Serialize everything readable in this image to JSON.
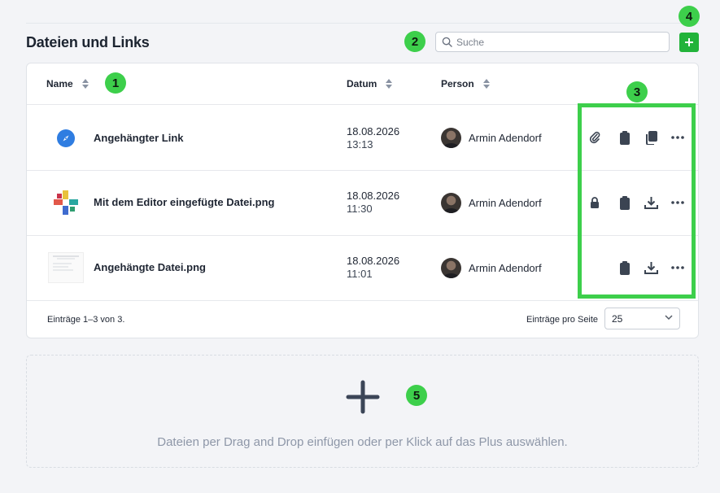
{
  "section": {
    "title": "Dateien und Links"
  },
  "search": {
    "placeholder": "Suche",
    "value": ""
  },
  "toolbar": {
    "add_icon": "plus-icon"
  },
  "table": {
    "columns": [
      {
        "label": "Name"
      },
      {
        "label": "Datum"
      },
      {
        "label": "Person"
      }
    ],
    "rows": [
      {
        "name": "Angehängter Link",
        "date": "18.08.2026",
        "time": "13:13",
        "person": "Armin Adendorf",
        "type": "link",
        "actions": [
          "paperclip-icon",
          "clipboard-icon",
          "copy-icon",
          "more-icon"
        ]
      },
      {
        "name": "Mit dem Editor eingefügte Datei.png",
        "date": "18.08.2026",
        "time": "11:30",
        "person": "Armin Adendorf",
        "type": "image",
        "actions": [
          "lock-icon",
          "clipboard-icon",
          "download-icon",
          "more-icon"
        ]
      },
      {
        "name": "Angehängte Datei.png",
        "date": "18.08.2026",
        "time": "11:01",
        "person": "Armin Adendorf",
        "type": "document",
        "actions": [
          "clipboard-icon",
          "download-icon",
          "more-icon"
        ]
      }
    ]
  },
  "footer": {
    "entries": "Einträge 1–3 von 3.",
    "per_page_label": "Einträge pro Seite",
    "per_page_value": "25"
  },
  "dropzone": {
    "text": "Dateien per Drag and Drop einfügen oder per Klick auf das Plus auswählen."
  },
  "badges": [
    "1",
    "2",
    "3",
    "4",
    "5"
  ],
  "colors": {
    "accent_green": "#22b33a",
    "badge_green": "#3dcf4b",
    "link_blue": "#2f7de1"
  }
}
